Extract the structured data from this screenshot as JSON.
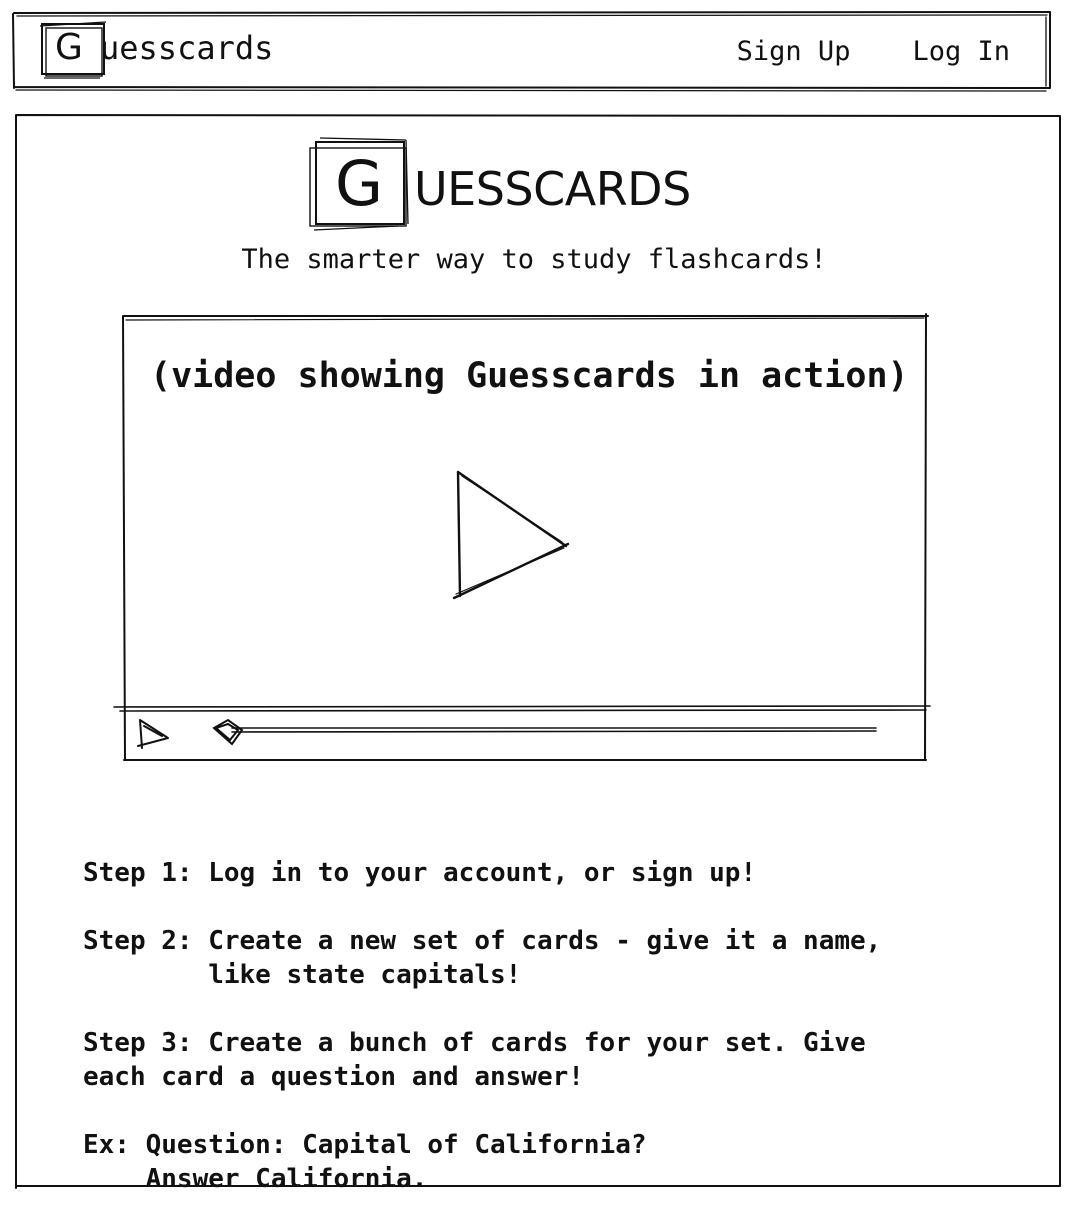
{
  "header": {
    "logo_letter": "G",
    "app_name": "uesscards",
    "nav": {
      "sign_up": "Sign Up",
      "log_in": "Log In"
    }
  },
  "hero": {
    "logo_letter": "G",
    "title": "UESSCARDS",
    "tagline": "The smarter way to study flashcards!"
  },
  "video": {
    "caption": "(video showing Guesscards in action)"
  },
  "steps": [
    "Step 1: Log in to your account, or sign up!",
    "Step 2: Create a new set of cards - give it a name,\n        like state capitals!",
    "Step 3: Create a bunch of cards for your set. Give\neach card a question and answer!",
    "Ex: Question: Capital of California?\n    Answer California."
  ]
}
